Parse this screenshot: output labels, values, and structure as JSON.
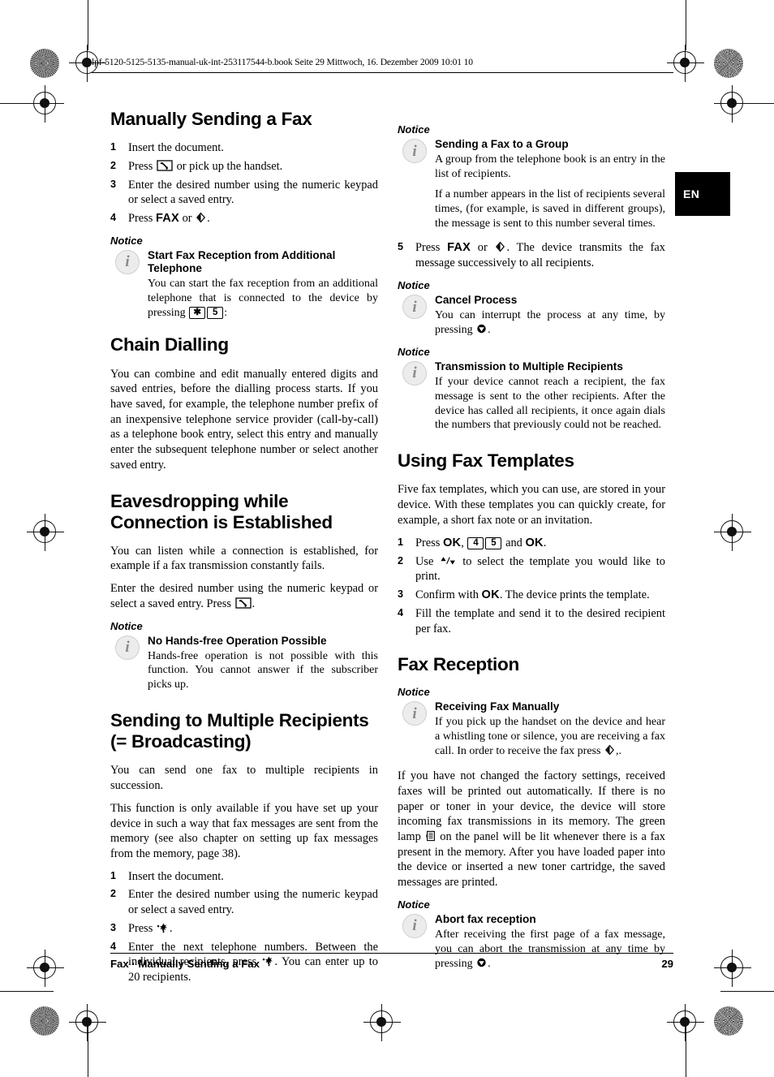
{
  "page": {
    "file_header": "lpf-5120-5125-5135-manual-uk-int-253117544-b.book  Seite 29  Mittwoch, 16. Dezember 2009  10:01 10",
    "language_tab": "EN",
    "footer_left": "Fax · Manually Sending a Fax",
    "footer_page": "29"
  },
  "left_column": {
    "s1": {
      "heading": "Manually Sending a Fax",
      "steps": [
        {
          "num": "1",
          "parts": [
            {
              "t": "text",
              "v": "Insert the document."
            }
          ]
        },
        {
          "num": "2",
          "parts": [
            {
              "t": "text",
              "v": "Press "
            },
            {
              "t": "icon",
              "v": "handset-icon"
            },
            {
              "t": "text",
              "v": " or pick up the handset."
            }
          ]
        },
        {
          "num": "3",
          "parts": [
            {
              "t": "text",
              "v": "Enter the desired number using the numeric keypad or select a saved entry."
            }
          ]
        },
        {
          "num": "4",
          "parts": [
            {
              "t": "text",
              "v": "Press "
            },
            {
              "t": "key",
              "v": "FAX"
            },
            {
              "t": "text",
              "v": " or "
            },
            {
              "t": "icon",
              "v": "start-icon"
            },
            {
              "t": "text",
              "v": "."
            }
          ]
        }
      ],
      "notice_label": "Notice",
      "notice": {
        "title": "Start Fax Reception from Additional Telephone",
        "body_pre": "You can start the fax reception from an additional telephone that is connected to the device by pressing ",
        "keycap_1": "✱",
        "keycap_2": "5",
        "body_post": ":"
      }
    },
    "s2": {
      "heading": "Chain Dialling",
      "body": "You can combine and edit manually entered digits and saved entries, before the dialling process starts. If you have saved, for example, the telephone number prefix of an inexpensive telephone service provider (call-by-call) as a telephone book entry, select this entry and manually enter the subsequent telephone number or select another saved entry."
    },
    "s3": {
      "heading": "Eavesdropping while Connection is Established",
      "body_1": "You can listen while a connection is established, for example if a fax transmission constantly fails.",
      "body_2_pre": "Enter the desired number using the numeric keypad or select a saved entry. Press ",
      "body_2_post": ".",
      "notice_label": "Notice",
      "notice": {
        "title": "No Hands-free Operation Possible",
        "body": "Hands-free operation is not possible with this function. You cannot answer if the subscriber picks up."
      }
    },
    "s4": {
      "heading": "Sending to Multiple Recipients (= Broadcasting)",
      "body_1": "You can send one fax to multiple recipients in succession.",
      "body_2": "This function is only available if you have set up your device in such a way that fax messages are sent from the memory (see also chapter on  setting up fax messages from the memory, page  38).",
      "steps": [
        {
          "num": "1",
          "parts": [
            {
              "t": "text",
              "v": "Insert the document."
            }
          ]
        },
        {
          "num": "2",
          "parts": [
            {
              "t": "text",
              "v": "Enter the desired number using the numeric keypad or select a saved entry."
            }
          ]
        },
        {
          "num": "3",
          "parts": [
            {
              "t": "text",
              "v": "Press "
            },
            {
              "t": "icon",
              "v": "broadcast-icon"
            },
            {
              "t": "text",
              "v": "."
            }
          ]
        },
        {
          "num": "4",
          "parts": [
            {
              "t": "text",
              "v": "Enter the next telephone numbers. Between the individual recipients, press "
            },
            {
              "t": "icon",
              "v": "broadcast-icon"
            },
            {
              "t": "text",
              "v": ". You can enter up to 20 recipients."
            }
          ]
        }
      ]
    }
  },
  "right_column": {
    "r1": {
      "notice_label": "Notice",
      "notice": {
        "title": "Sending a Fax to a Group",
        "body_1": "A group from the telephone book is an entry in the list of recipients.",
        "body_2": "If a number appears in the list of recipients several times, (for example, is saved in different groups), the message is sent to this number several times."
      },
      "step5": {
        "num": "5",
        "pre": "Press ",
        "key": "FAX",
        "mid": " or ",
        "post": ". The device transmits the fax message successively to all recipients."
      }
    },
    "r2": {
      "notice_label": "Notice",
      "notice": {
        "title": "Cancel Process",
        "body_pre": "You can interrupt the process at any time, by pressing ",
        "body_post": "."
      }
    },
    "r3": {
      "notice_label": "Notice",
      "notice": {
        "title": "Transmission to Multiple Recipients",
        "body": "If your device cannot reach a recipient, the fax message is sent to the other recipients. After the device has called all recipients, it once again dials the numbers that previously could not be reached."
      }
    },
    "r4": {
      "heading": "Using Fax Templates",
      "body": "Five fax templates, which you can use, are stored in your device. With these templates you can quickly create, for example, a short fax note or an invitation.",
      "steps": [
        {
          "num": "1",
          "parts": [
            {
              "t": "text",
              "v": "Press "
            },
            {
              "t": "key",
              "v": "OK"
            },
            {
              "t": "text",
              "v": ", "
            },
            {
              "t": "cap",
              "v": "4"
            },
            {
              "t": "cap",
              "v": "5"
            },
            {
              "t": "text",
              "v": " and "
            },
            {
              "t": "key",
              "v": "OK"
            },
            {
              "t": "text",
              "v": "."
            }
          ]
        },
        {
          "num": "2",
          "parts": [
            {
              "t": "text",
              "v": "Use "
            },
            {
              "t": "icon",
              "v": "up-down-arrows-icon"
            },
            {
              "t": "text",
              "v": " to select the template you would like to print."
            }
          ]
        },
        {
          "num": "3",
          "parts": [
            {
              "t": "text",
              "v": "Confirm with "
            },
            {
              "t": "key",
              "v": "OK"
            },
            {
              "t": "text",
              "v": ". The device prints the template."
            }
          ]
        },
        {
          "num": "4",
          "parts": [
            {
              "t": "text",
              "v": "Fill the template and send it to the desired recipient per fax."
            }
          ]
        }
      ]
    },
    "r5": {
      "heading": "Fax Reception",
      "notice_label": "Notice",
      "notice": {
        "title": "Receiving Fax Manually",
        "body_pre": "If you pick up the handset on the device and hear a whistling tone or silence, you are receiving a fax call. In order to receive the fax press ",
        "body_post": ",."
      },
      "body_pre": "If you have not changed the factory settings, received faxes will be printed out automatically. If there is no paper or toner in your device, the device will store incoming fax transmissions in its memory. The green lamp ",
      "body_post": " on the panel will be lit whenever there is a fax present in the memory.  After you have loaded paper into the device or inserted a new toner cartridge, the saved messages are printed."
    },
    "r6": {
      "notice_label": "Notice",
      "notice": {
        "title": "Abort fax reception",
        "body_pre": "After receiving the first page of a fax message, you can abort the transmission at any time by pressing ",
        "body_post": "."
      }
    }
  },
  "colors": {
    "ink": "#000000",
    "tab_background": "#000000",
    "tab_text": "#ffffff",
    "info_icon_fill": "#ececec",
    "info_icon_glyph": "#8a8a8a"
  }
}
